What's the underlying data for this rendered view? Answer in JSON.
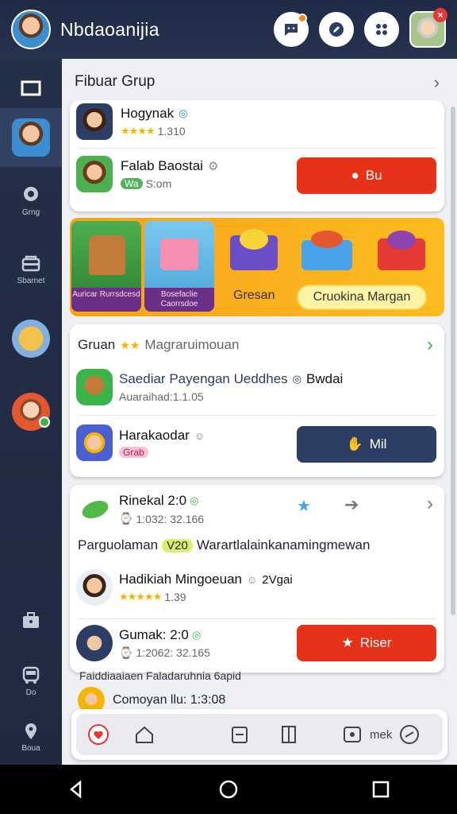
{
  "header": {
    "title": "Nbdaoanijia"
  },
  "rail": {
    "labels": [
      "Grng",
      "Sbarnet",
      "Do",
      "Boua"
    ]
  },
  "main": {
    "section_title": "Fibuar Grup",
    "card1": {
      "items": [
        {
          "name": "Hogynak",
          "rating": "1.310",
          "stars": "★★★★"
        },
        {
          "name": "Falab Baostai",
          "tag": "Wa",
          "meta": "S:om",
          "action": "Bu"
        }
      ]
    },
    "banner": {
      "tiles": [
        {
          "caption": "Auricar Rurrsdcesd"
        },
        {
          "caption": "Bosefaclie Caorrsdoe"
        }
      ],
      "chest_label": "Gresan",
      "pill_label": "Cruokina Margan"
    },
    "card2": {
      "title": "Gruan",
      "subtitle": "Magraruimouan",
      "items": [
        {
          "name": "Saediar Payengan Ueddhes",
          "tag": "Bwdai",
          "sub": "Auaraihad:1.1.05"
        },
        {
          "name": "Harakaodar",
          "badge": "Grab",
          "action": "Mil"
        }
      ]
    },
    "card3": {
      "header_title": "Rinekal 2:0",
      "header_sub": "1:032: 32.166",
      "promo_prefix": "Parguolaman",
      "promo_tag": "V20",
      "promo_suffix": "Warartlalainkanamingmewan",
      "items": [
        {
          "name": "Hadikiah Mingoeuan",
          "tag": "2Vgai",
          "rating": "1.39",
          "stars": "★★★★★"
        },
        {
          "name": "Gumak: 2:0",
          "sub": "1:2062: 32.165",
          "action": "Riser"
        }
      ]
    },
    "footer_line": "Faiddiaaiaen  Faladaruhnia  6apid",
    "peek_item": "Comoyan llu: 1:3:08"
  },
  "dock": {
    "label": "mek"
  },
  "colors": {
    "header_bg": "#1f2a47",
    "accent_red": "#e53218",
    "accent_navy": "#2c3e64",
    "banner_orange": "#f7a21b"
  }
}
